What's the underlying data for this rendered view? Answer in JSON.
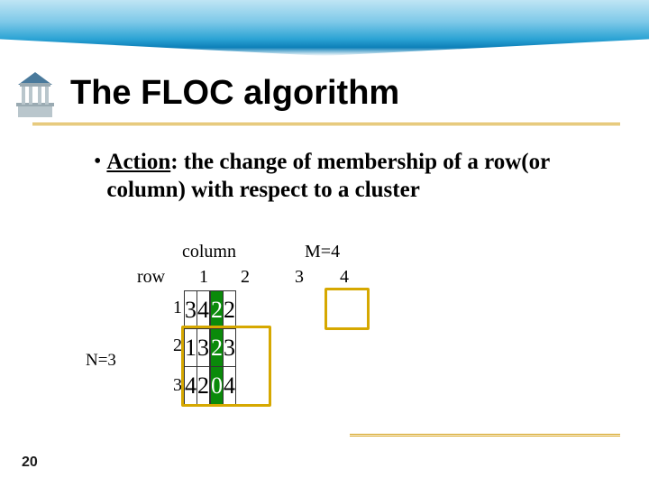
{
  "title": "The FLOC algorithm",
  "bullet": {
    "action_label": "Action",
    "rest": ": the change of membership of a row(or column) with respect to a cluster"
  },
  "matrix": {
    "label_column": "column",
    "label_row": "row",
    "label_m": "M=4",
    "label_n": "N=3",
    "col_headers": [
      "1",
      "2",
      "3",
      "4"
    ],
    "row_headers": [
      "1",
      "2",
      "3"
    ],
    "cells": [
      [
        "3",
        "4",
        "2",
        "2"
      ],
      [
        "1",
        "3",
        "2",
        "3"
      ],
      [
        "4",
        "2",
        "0",
        "4"
      ]
    ]
  },
  "page_number": "20",
  "chart_data": {
    "type": "table",
    "title": "FLOC algorithm action matrix",
    "row_label": "row (N=3)",
    "col_label": "column (M=4)",
    "columns": [
      1,
      2,
      3,
      4
    ],
    "rows": [
      1,
      2,
      3
    ],
    "values": [
      [
        3,
        4,
        2,
        2
      ],
      [
        1,
        3,
        2,
        3
      ],
      [
        4,
        2,
        0,
        4
      ]
    ],
    "highlights": {
      "green_column": 3,
      "yellow_box_regions": [
        {
          "rows": [
            2,
            3
          ],
          "cols": [
            1,
            2
          ]
        },
        {
          "rows": [
            1
          ],
          "cols": [
            4
          ]
        }
      ]
    }
  }
}
